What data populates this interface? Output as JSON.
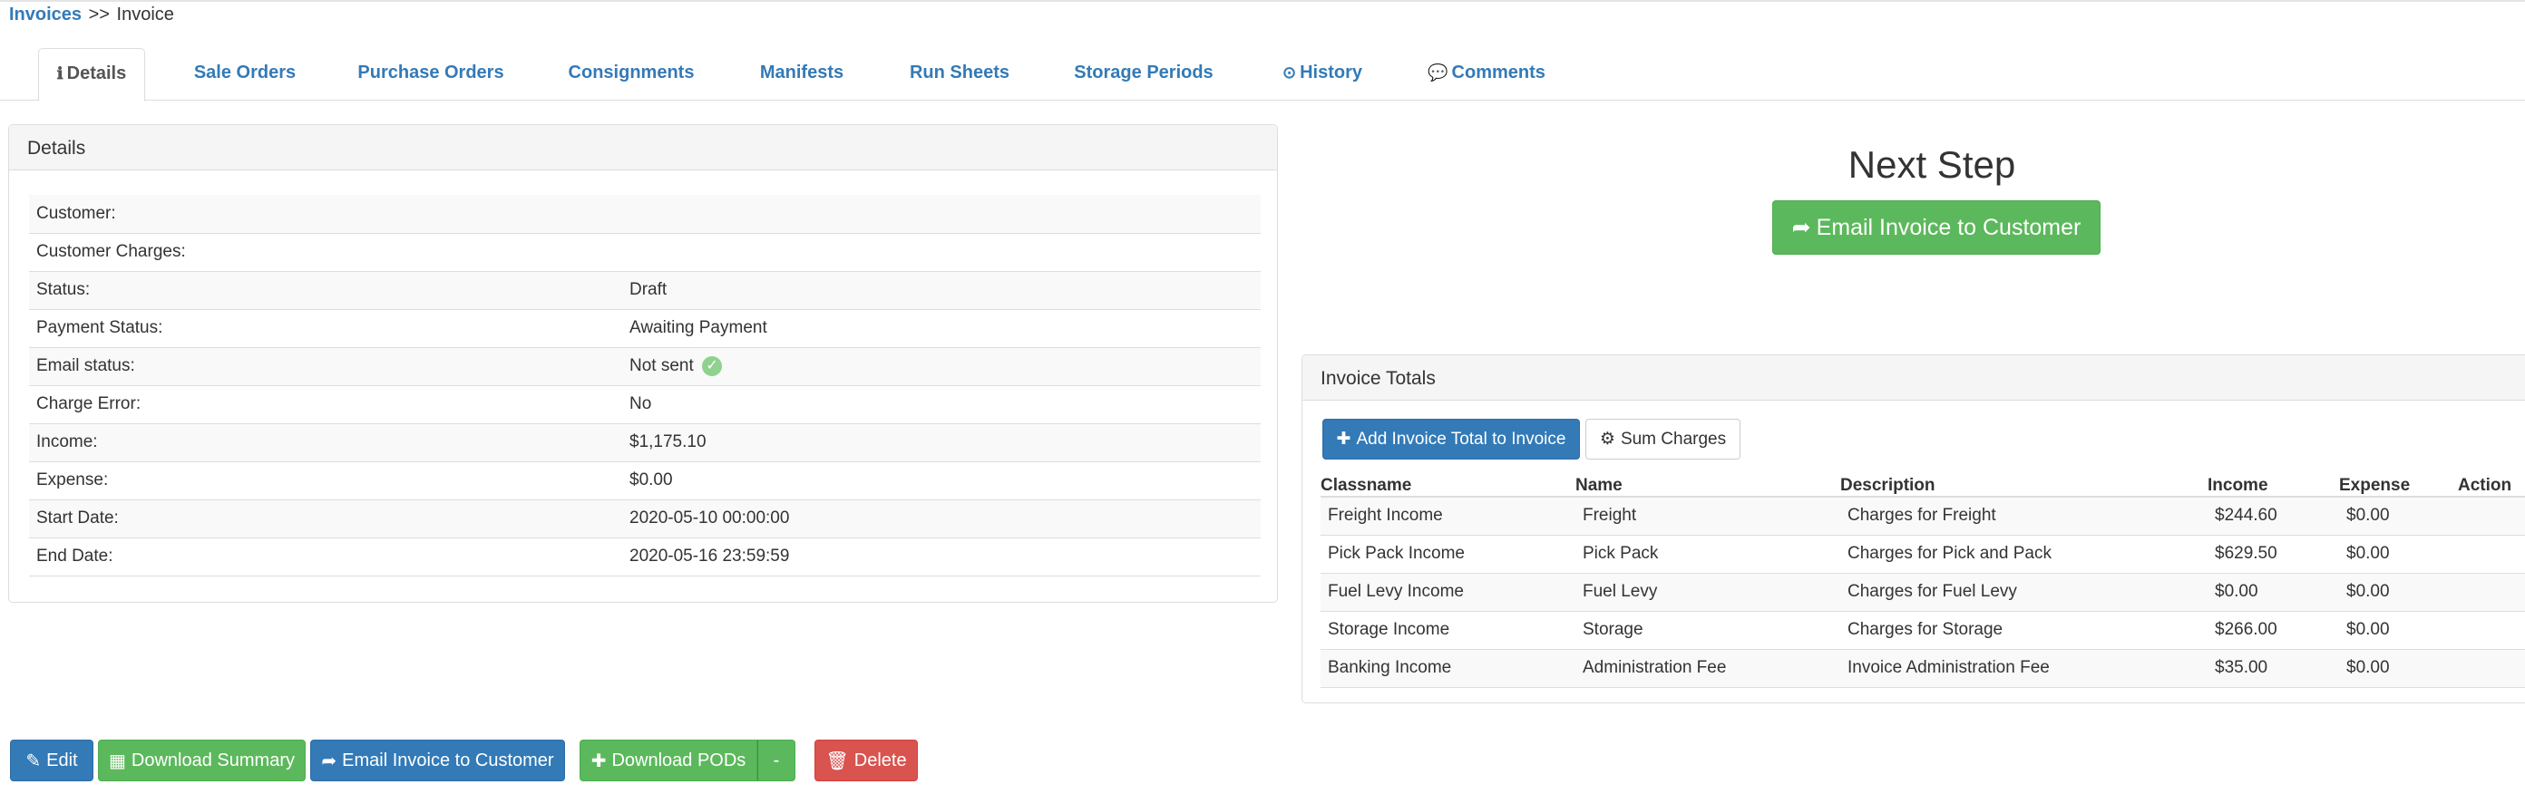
{
  "breadcrumb": {
    "root": "Invoices",
    "separator": ">>",
    "current": "Invoice"
  },
  "tabs": [
    {
      "label": "Details",
      "icon": "info-icon",
      "active": true
    },
    {
      "label": "Sale Orders"
    },
    {
      "label": "Purchase Orders"
    },
    {
      "label": "Consignments"
    },
    {
      "label": "Manifests"
    },
    {
      "label": "Run Sheets"
    },
    {
      "label": "Storage Periods"
    },
    {
      "label": "History",
      "icon": "clock-icon"
    },
    {
      "label": "Comments",
      "icon": "comment-icon"
    }
  ],
  "details": {
    "heading": "Details",
    "rows": [
      {
        "label": "Customer:",
        "value": ""
      },
      {
        "label": "Customer Charges:",
        "value": ""
      },
      {
        "label": "Status:",
        "value": "Draft"
      },
      {
        "label": "Payment Status:",
        "value": "Awaiting Payment"
      },
      {
        "label": "Email status:",
        "value": "Not sent"
      },
      {
        "label": "Charge Error:",
        "value": "No"
      },
      {
        "label": "Income:",
        "value": "$1,175.10"
      },
      {
        "label": "Expense:",
        "value": "$0.00"
      },
      {
        "label": "Start Date:",
        "value": "2020-05-10 00:00:00"
      },
      {
        "label": "End Date:",
        "value": "2020-05-16 23:59:59"
      }
    ]
  },
  "next_step": {
    "title": "Next Step",
    "button_label": "Email Invoice to Customer"
  },
  "invoice_totals": {
    "heading": "Invoice Totals",
    "add_button": "Add Invoice Total to Invoice",
    "sum_button": "Sum Charges",
    "columns": [
      "Classname",
      "Name",
      "Description",
      "Income",
      "Expense",
      "Action"
    ],
    "rows": [
      [
        "Freight Income",
        "Freight",
        "Charges for Freight",
        "$244.60",
        "$0.00",
        ""
      ],
      [
        "Pick Pack Income",
        "Pick Pack",
        "Charges for Pick and Pack",
        "$629.50",
        "$0.00",
        ""
      ],
      [
        "Fuel Levy Income",
        "Fuel Levy",
        "Charges for Fuel Levy",
        "$0.00",
        "$0.00",
        ""
      ],
      [
        "Storage Income",
        "Storage",
        "Charges for Storage",
        "$266.00",
        "$0.00",
        ""
      ],
      [
        "Banking Income",
        "Administration Fee",
        "Invoice Administration Fee",
        "$35.00",
        "$0.00",
        ""
      ]
    ]
  },
  "actions": {
    "edit": "Edit",
    "download_summary": "Download Summary",
    "email_invoice": "Email Invoice to Customer",
    "download_pods": "Download PODs",
    "dropdown_caret": "-",
    "delete": "Delete"
  },
  "colors": {
    "link": "#337ab7",
    "success": "#5cb85c",
    "primary": "#337ab7",
    "danger": "#d9534f"
  }
}
